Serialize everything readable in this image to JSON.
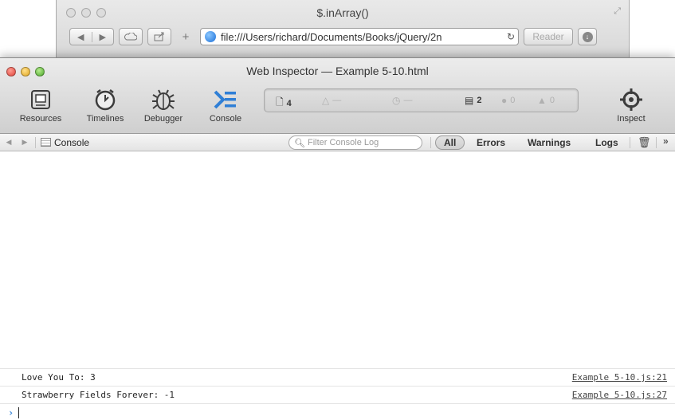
{
  "safari": {
    "title": "$.inArray()",
    "back": "◀",
    "forward": "▶",
    "url": "file:///Users/richard/Documents/Books/jQuery/2n",
    "reader": "Reader",
    "add": "+"
  },
  "inspector": {
    "title": "Web Inspector — Example 5-10.html",
    "tools": [
      {
        "label": "Resources",
        "icon": "resources-icon"
      },
      {
        "label": "Timelines",
        "icon": "timelines-icon"
      },
      {
        "label": "Debugger",
        "icon": "debugger-icon"
      },
      {
        "label": "Console",
        "icon": "console-icon"
      }
    ],
    "inspect_label": "Inspect",
    "status": {
      "resources": "4",
      "warnings_dim": "—",
      "time": "—",
      "logs": "2",
      "errors": "0",
      "issues": "0"
    }
  },
  "subbar": {
    "crumb": "Console",
    "filter_placeholder": "Filter Console Log",
    "scopes": {
      "all": "All",
      "errors": "Errors",
      "warnings": "Warnings",
      "logs": "Logs"
    }
  },
  "console": {
    "messages": [
      {
        "text": "Love You To: 3",
        "source": "Example 5-10.js:21"
      },
      {
        "text": "Strawberry Fields Forever: -1",
        "source": "Example 5-10.js:27"
      }
    ],
    "prompt": "›"
  },
  "colors": {
    "accent": "#3b86d8",
    "close": "#e0443a",
    "minimize": "#e0a520",
    "maximize": "#4ca72a"
  }
}
